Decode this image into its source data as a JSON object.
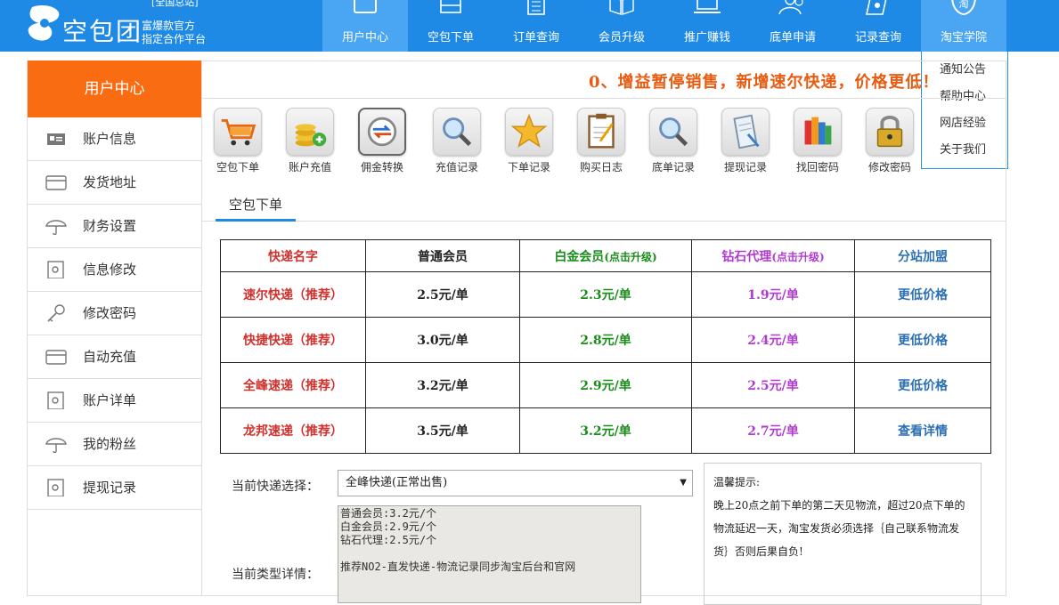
{
  "brand": {
    "name": "空包团",
    "slogan1": "富爆款官方",
    "slogan2": "指定合作平台",
    "tag": "[全国总站]"
  },
  "nav": [
    {
      "label": "用户中心",
      "icon": "monitor-icon",
      "active": true
    },
    {
      "label": "空包下单",
      "icon": "box-icon"
    },
    {
      "label": "订单查询",
      "icon": "list-icon"
    },
    {
      "label": "会员升级",
      "icon": "book-icon"
    },
    {
      "label": "推广赚钱",
      "icon": "laptop-icon"
    },
    {
      "label": "底单申请",
      "icon": "users-icon"
    },
    {
      "label": "记录查询",
      "icon": "record-icon"
    },
    {
      "label": "淘宝学院",
      "icon": "taobao-icon"
    }
  ],
  "dropdown": [
    "通知公告",
    "帮助中心",
    "网店经验",
    "关于我们"
  ],
  "sidebar": {
    "title": "用户中心",
    "items": [
      {
        "label": "账户信息",
        "icon": "id-card-icon"
      },
      {
        "label": "发货地址",
        "icon": "card-icon"
      },
      {
        "label": "财务设置",
        "icon": "umbrella-icon"
      },
      {
        "label": "信息修改",
        "icon": "wallet-icon"
      },
      {
        "label": "修改密码",
        "icon": "key-icon"
      },
      {
        "label": "自动充值",
        "icon": "card-icon"
      },
      {
        "label": "账户详单",
        "icon": "wallet-icon"
      },
      {
        "label": "我的粉丝",
        "icon": "umbrella-icon"
      },
      {
        "label": "提现记录",
        "icon": "wallet-icon"
      }
    ]
  },
  "notice": "0、增益暂停销售，新增速尔快递，价格更低！",
  "tools": [
    {
      "label": "空包下单",
      "icon": "cart-icon"
    },
    {
      "label": "账户充值",
      "icon": "coins-icon"
    },
    {
      "label": "佣金转换",
      "icon": "convert-icon"
    },
    {
      "label": "充值记录",
      "icon": "magnifier-icon"
    },
    {
      "label": "下单记录",
      "icon": "star-icon"
    },
    {
      "label": "购买日志",
      "icon": "clipboard-icon"
    },
    {
      "label": "底单记录",
      "icon": "magnifier-icon"
    },
    {
      "label": "提现记录",
      "icon": "document-icon"
    },
    {
      "label": "找回密码",
      "icon": "books-icon"
    },
    {
      "label": "修改密码",
      "icon": "lock-icon"
    }
  ],
  "tab": "空包下单",
  "table": {
    "headers": {
      "courier": "快递名字",
      "normal": "普通会员",
      "platinum": "白金会员",
      "platinum_hint": "(点击升级)",
      "diamond": "钻石代理",
      "diamond_hint": "(点击升级)",
      "branch": "分站加盟"
    },
    "rows": [
      {
        "courier": "速尔快递（推荐）",
        "normal": "2.5元/单",
        "platinum": "2.3元/单",
        "diamond": "1.9元/单",
        "branch": "更低价格"
      },
      {
        "courier": "快捷快递（推荐）",
        "normal": "3.0元/单",
        "platinum": "2.8元/单",
        "diamond": "2.4元/单",
        "branch": "更低价格"
      },
      {
        "courier": "全峰速递（推荐）",
        "normal": "3.2元/单",
        "platinum": "2.9元/单",
        "diamond": "2.5元/单",
        "branch": "更低价格"
      },
      {
        "courier": "龙邦速递（推荐）",
        "normal": "3.5元/单",
        "platinum": "3.2元/单",
        "diamond": "2.7元/单",
        "branch": "查看详情"
      }
    ]
  },
  "form": {
    "select_label": "当前快递选择：",
    "select_value": "全峰快递(正常出售)",
    "detail_label": "当前类型详情：",
    "detail_text": "普通会员:3.2元/个\n白金会员:2.9元/个\n钻石代理:2.5元/个\n\n推荐NO2-直发快递-物流记录同步淘宝后台和官网"
  },
  "tips": {
    "title": "温馨提示:",
    "body": "晚上20点之前下单的第二天见物流，超过20点下单的物流延迟一天，淘宝发货必须选择｛自己联系物流发货｝否则后果自负!"
  },
  "colors": {
    "nav_bg": "#1e8ae6",
    "nav_active": "#4aa6f2",
    "sidebar_head": "#fa6c12",
    "notice": "#e85b10"
  }
}
